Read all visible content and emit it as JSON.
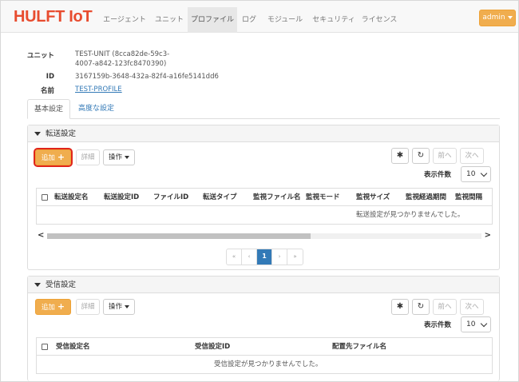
{
  "brand": "HULFT IoT",
  "nav": [
    {
      "label": "エージェント",
      "active": false
    },
    {
      "label": "ユニット",
      "active": false
    },
    {
      "label": "プロファイル",
      "active": true
    },
    {
      "label": "ログ",
      "active": false
    },
    {
      "label": "モジュール",
      "active": false
    },
    {
      "label": "セキュリティ",
      "active": false
    },
    {
      "label": "ライセンス",
      "active": false
    }
  ],
  "user_menu": "admin",
  "info": {
    "unit_label": "ユニット",
    "unit_value_line1": "TEST-UNIT  (8cca82de-59c3-",
    "unit_value_line2": "4007-a842-123fc8470390)",
    "id_label": "ID",
    "id_value": "3167159b-3648-432a-82f4-a16fe5141dd6",
    "name_label": "名前",
    "name_value": "TEST-PROFILE"
  },
  "tabs": [
    {
      "label": "基本設定",
      "active": true
    },
    {
      "label": "高度な設定",
      "active": false
    }
  ],
  "transfer": {
    "title": "転送設定",
    "add_label": "追加",
    "detail_label": "詳細",
    "ops_label": "操作",
    "prev_label": "前へ",
    "next_label": "次へ",
    "count_label": "表示件数",
    "count_value": "10",
    "columns": [
      "転送設定名",
      "転送設定ID",
      "ファイルID",
      "転送タイプ",
      "監視ファイル名",
      "監視モード",
      "監視サイズ",
      "監視経過期間",
      "監視間隔"
    ],
    "empty_text": "転送設定が見つかりませんでした。",
    "pager": [
      "«",
      "‹",
      "1",
      "›",
      "»"
    ]
  },
  "receive": {
    "title": "受信設定",
    "add_label": "追加",
    "detail_label": "詳細",
    "ops_label": "操作",
    "prev_label": "前へ",
    "next_label": "次へ",
    "count_label": "表示件数",
    "count_value": "10",
    "columns": [
      "受信設定名",
      "受信設定ID",
      "配置先ファイル名"
    ],
    "empty_text": "受信設定が見つかりませんでした。"
  }
}
